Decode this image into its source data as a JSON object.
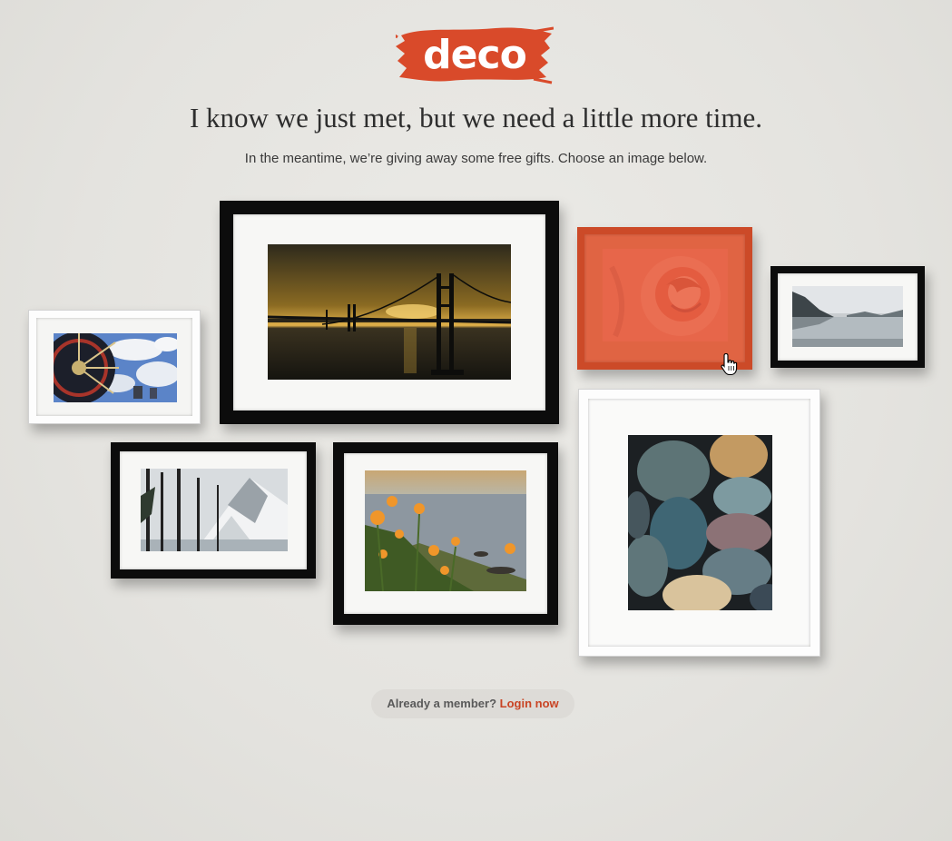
{
  "brand": {
    "logo_text": "deco",
    "accent_color": "#d94a2a"
  },
  "hero": {
    "headline": "I know we just met, but we need a little more time.",
    "subline": "In the meantime, we’re giving away some free gifts. Choose an image below."
  },
  "gallery": {
    "frames": [
      {
        "name": "bridge-sunset",
        "frame_color": "black",
        "selected": false
      },
      {
        "name": "carousel-ride",
        "frame_color": "white",
        "selected": false
      },
      {
        "name": "rose",
        "frame_color": "orange",
        "selected": true
      },
      {
        "name": "fjord-reflection",
        "frame_color": "black",
        "selected": false
      },
      {
        "name": "snowy-mountain",
        "frame_color": "black",
        "selected": false
      },
      {
        "name": "poppies-coast",
        "frame_color": "black",
        "selected": false
      },
      {
        "name": "river-stones",
        "frame_color": "white",
        "selected": false
      }
    ]
  },
  "footer": {
    "member_question": "Already a member?",
    "login_label": "Login now"
  },
  "icons": {
    "cursor": "hand-pointer-icon"
  }
}
